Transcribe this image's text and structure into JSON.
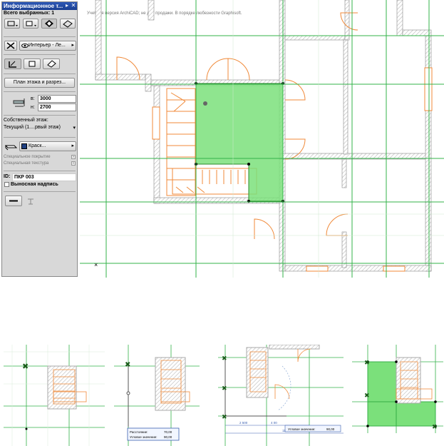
{
  "infobox": {
    "title": "Информационное т...",
    "selection_count_label": "Всего выбранных: 1",
    "layer_dropdown": "Интерьер - Ле...",
    "plan_section_button": "План этажа и разрез...",
    "thickness_label": "в:",
    "thickness_value": "3000",
    "elevation_label": "н:",
    "elevation_value": "2700",
    "home_story_label": "Собственный этаж:",
    "home_story_value": "Текущий (1....рвый этаж)",
    "material_dropdown": "Краск...",
    "special_covering_label": "Специальное покрытие",
    "special_texture_label": "Специальная текстура",
    "id_label": "ID:",
    "id_value": "ПКР 003",
    "leader_label": "Выносная надпись"
  },
  "plan": {
    "watermark": "Учебная версия ArchiCAD; не для продажи. В порядке любезности Graphisoft.",
    "colors": {
      "grid": "#33b34a",
      "wall_hatch": "#b8b8b8",
      "furniture": "#f08a3a",
      "slab_fill": "#7be07b",
      "slab_edge": "#2c8a2c"
    }
  },
  "thumbnails": {
    "thumb2_tooltip_line1": "Расстояние:",
    "thumb2_tooltip_line2": "Угловое значение:",
    "thumb2_tooltip_value1": "70,00",
    "thumb2_tooltip_value2": "90,00",
    "thumb3_dim1": "2 500",
    "thumb3_dim2": "4 00",
    "thumb3_dim3": "11 000",
    "thumb3_tooltip": "Угловое значение:",
    "thumb3_tooltip_value": "90,00"
  }
}
